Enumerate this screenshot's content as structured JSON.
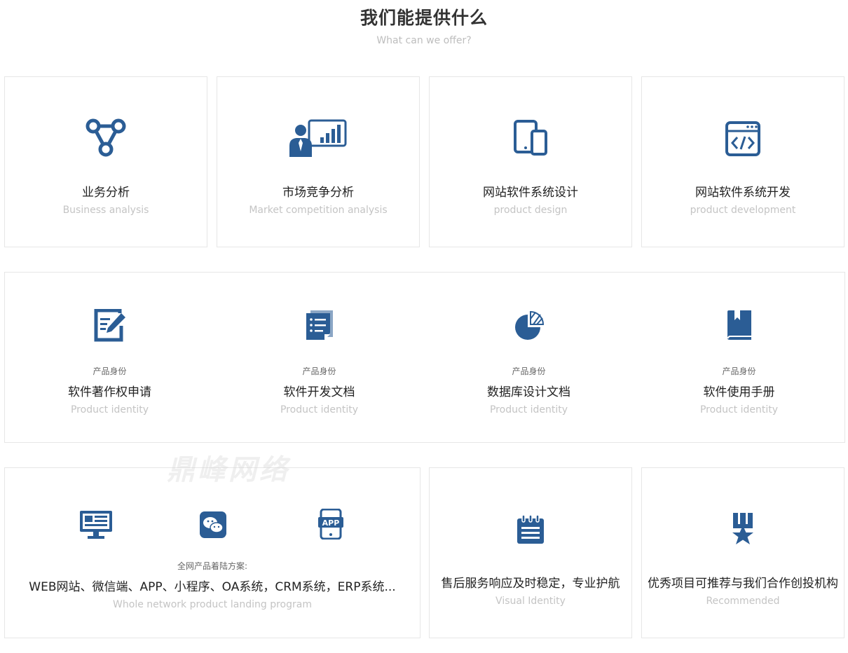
{
  "header": {
    "title": "我们能提供什么",
    "subtitle": "What can we offer?"
  },
  "row1": [
    {
      "icon": "network-triangle-icon",
      "title": "业务分析",
      "en": "Business analysis"
    },
    {
      "icon": "presentation-chart-icon",
      "title": "市场竞争分析",
      "en": "Market competition analysis"
    },
    {
      "icon": "devices-icon",
      "title": "网站软件系统设计",
      "en": "product design"
    },
    {
      "icon": "code-window-icon",
      "title": "网站软件系统开发",
      "en": "product development"
    }
  ],
  "row2": [
    {
      "icon": "edit-document-icon",
      "label": "产品身份",
      "title": "软件著作权申请",
      "en": "Product identity"
    },
    {
      "icon": "list-document-icon",
      "label": "产品身份",
      "title": "软件开发文档",
      "en": "Product identity"
    },
    {
      "icon": "pie-chart-icon",
      "label": "产品身份",
      "title": "数据库设计文档",
      "en": "Product identity"
    },
    {
      "icon": "book-icon",
      "label": "产品身份",
      "title": "软件使用手册",
      "en": "Product identity"
    }
  ],
  "row3": {
    "wide": {
      "icons": [
        "monitor-icon",
        "wechat-icon",
        "app-phone-icon"
      ],
      "label": "全网产品着陆方案:",
      "title": "WEB网站、微信端、APP、小程序、OA系统，CRM系统，ERP系统...",
      "en": "Whole network product landing program"
    },
    "service": {
      "icon": "notepad-icon",
      "title": "售后服务响应及时稳定，专业护航",
      "en": "Visual Identity"
    },
    "recommend": {
      "icon": "medal-icon",
      "title": "优秀项目可推荐与我们合作创投机构",
      "en": "Recommended"
    }
  },
  "watermark": "鼎峰网络",
  "colors": {
    "icon": "#2b5d95",
    "text": "#222222",
    "muted": "#c4c4c4"
  }
}
